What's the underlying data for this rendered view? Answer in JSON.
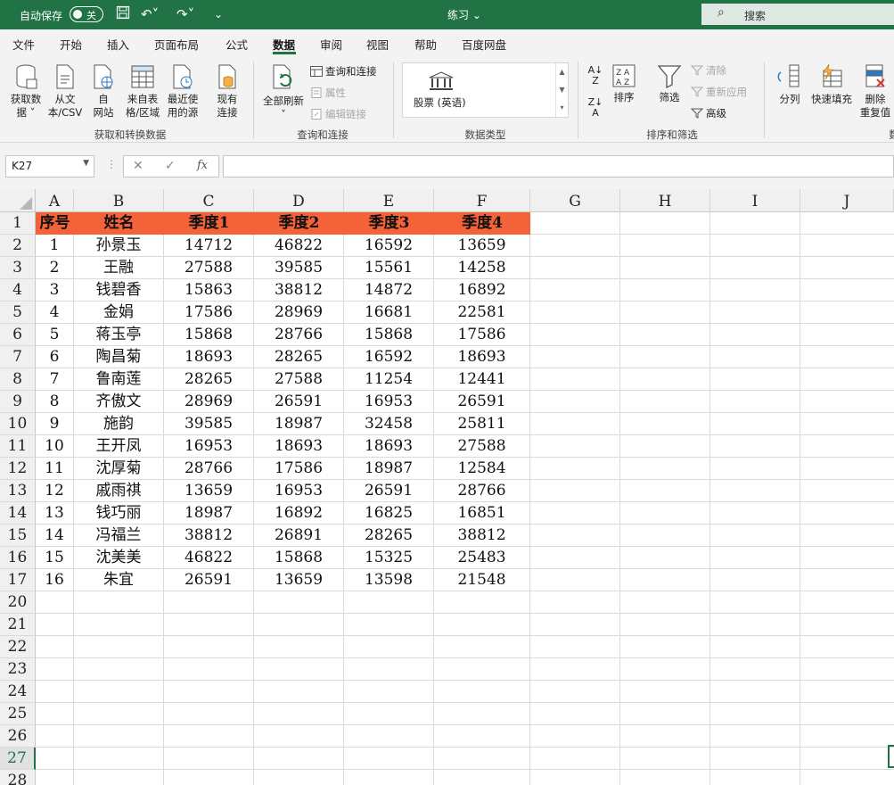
{
  "titlebar": {
    "autosave_label": "自动保存",
    "autosave_state": "关",
    "doc_title": "练习 ⌄",
    "search_placeholder": "搜索"
  },
  "menu_tabs": [
    "文件",
    "开始",
    "插入",
    "页面布局",
    "公式",
    "数据",
    "审阅",
    "视图",
    "帮助",
    "百度网盘"
  ],
  "active_tab": "数据",
  "ribbon": {
    "get_data": "获取数\n据 ˅",
    "from_text": "从文\n本/CSV",
    "from_web": "自\n网站",
    "from_table": "来自表\n格/区域",
    "recent_sources": "最近使\n用的源",
    "existing_conn": "现有\n连接",
    "refresh_all": "全部刷新\n˅",
    "queries_conn": "查询和连接",
    "properties": "属性",
    "edit_links": "编辑链接",
    "stock": "股票 (英语)",
    "sort_az": "A↓Z",
    "sort": "排序",
    "filter": "筛选",
    "clear": "清除",
    "reapply": "重新应用",
    "advanced": "高级",
    "text_to_columns": "分列",
    "flash_fill": "快速填充",
    "remove_dup": "删除\n重复值",
    "group_get_transform": "获取和转换数据",
    "group_queries": "查询和连接",
    "group_datatypes": "数据类型",
    "group_sort_filter": "排序和筛选",
    "group_tools": "数"
  },
  "formula": {
    "name_box": "K27",
    "fx": "fx",
    "value": ""
  },
  "columns": [
    "A",
    "B",
    "C",
    "D",
    "E",
    "F",
    "G",
    "H",
    "I",
    "J"
  ],
  "row_numbers": [
    "1",
    "2",
    "3",
    "4",
    "5",
    "6",
    "7",
    "8",
    "9",
    "10",
    "11",
    "12",
    "13",
    "14",
    "15",
    "16",
    "17",
    "20",
    "21",
    "22",
    "23",
    "24",
    "25",
    "26",
    "27",
    "28"
  ],
  "selected_row": "27",
  "table": {
    "headers": [
      "序号",
      "姓名",
      "季度1",
      "季度2",
      "季度3",
      "季度4"
    ],
    "rows": [
      [
        "1",
        "孙景玉",
        "14712",
        "46822",
        "16592",
        "13659"
      ],
      [
        "2",
        "王融",
        "27588",
        "39585",
        "15561",
        "14258"
      ],
      [
        "3",
        "钱碧香",
        "15863",
        "38812",
        "14872",
        "16892"
      ],
      [
        "4",
        "金娟",
        "17586",
        "28969",
        "16681",
        "22581"
      ],
      [
        "5",
        "蒋玉亭",
        "15868",
        "28766",
        "15868",
        "17586"
      ],
      [
        "6",
        "陶昌菊",
        "18693",
        "28265",
        "16592",
        "18693"
      ],
      [
        "7",
        "鲁南莲",
        "28265",
        "27588",
        "11254",
        "12441"
      ],
      [
        "8",
        "齐傲文",
        "28969",
        "26591",
        "16953",
        "26591"
      ],
      [
        "9",
        "施韵",
        "39585",
        "18987",
        "32458",
        "25811"
      ],
      [
        "10",
        "王开凤",
        "16953",
        "18693",
        "18693",
        "27588"
      ],
      [
        "11",
        "沈厚菊",
        "28766",
        "17586",
        "18987",
        "12584"
      ],
      [
        "12",
        "戚雨祺",
        "13659",
        "16953",
        "26591",
        "28766"
      ],
      [
        "13",
        "钱巧丽",
        "18987",
        "16892",
        "16825",
        "16851"
      ],
      [
        "14",
        "冯福兰",
        "38812",
        "26891",
        "28265",
        "38812"
      ],
      [
        "15",
        "沈美美",
        "46822",
        "15868",
        "15325",
        "25483"
      ],
      [
        "16",
        "朱宜",
        "26591",
        "13659",
        "13598",
        "21548"
      ]
    ]
  },
  "colors": {
    "excel_green": "#217346",
    "header_fill": "#f4623a"
  }
}
